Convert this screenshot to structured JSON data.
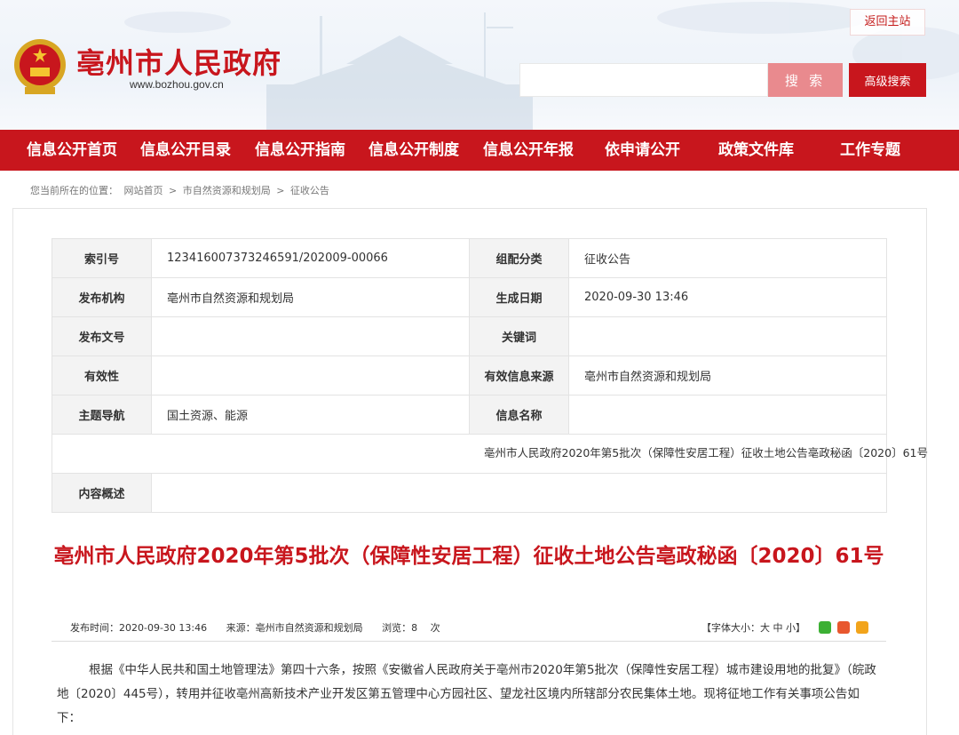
{
  "header": {
    "site_title": "亳州市人民政府",
    "site_url": "www.bozhou.gov.cn",
    "home_link": "返回主站",
    "search_placeholder": "",
    "search_button": "搜 索",
    "advanced_search": "高级搜索"
  },
  "nav": [
    {
      "label": "信息公开首页"
    },
    {
      "label": "信息公开目录"
    },
    {
      "label": "信息公开指南"
    },
    {
      "label": "信息公开制度"
    },
    {
      "label": "信息公开年报"
    },
    {
      "label": "依申请公开"
    },
    {
      "label": "政策文件库"
    },
    {
      "label": "工作专题"
    }
  ],
  "breadcrumb": {
    "prefix": "您当前所在的位置：",
    "items": [
      "网站首页",
      "市自然资源和规划局",
      "征收公告"
    ],
    "separator": ">"
  },
  "meta": {
    "index_label": "索引号",
    "index_value": "123416007373246591/202009-00066",
    "category_label": "组配分类",
    "category_value": "征收公告",
    "publisher_label": "发布机构",
    "publisher_value": "亳州市自然资源和规划局",
    "date_label": "生成日期",
    "date_value": "2020-09-30 13:46",
    "docno_label": "发布文号",
    "docno_value": "",
    "keywords_label": "关键词",
    "keywords_value": "",
    "validity_label": "有效性",
    "validity_value": "",
    "source_label": "有效信息来源",
    "source_value": "亳州市自然资源和规划局",
    "topic_label": "主题导航",
    "topic_value": "国土资源、能源",
    "infoname_label": "信息名称",
    "infoname_value": "亳州市人民政府2020年第5批次（保障性安居工程）征收土地公告亳政秘函〔2020〕61号",
    "summary_label": "内容概述",
    "summary_value": ""
  },
  "article": {
    "title": "亳州市人民政府2020年第5批次（保障性安居工程）征收土地公告亳政秘函〔2020〕61号",
    "publish_time": "发布时间：2020-09-30 13:46",
    "source": "来源：亳州市自然资源和规划局",
    "views": "浏览：8　 次",
    "font_size": "【字体大小：大 中 小】",
    "body": "根据《中华人民共和国土地管理法》第四十六条，按照《安徽省人民政府关于亳州市2020年第5批次（保障性安居工程）城市建设用地的批复》（皖政地〔2020〕445号），转用并征收亳州高新技术产业开发区第五管理中心方园社区、望龙社区境内所辖部分农民集体土地。现将征地工作有关事项公告如下："
  },
  "colors": {
    "brand_red": "#c8161d",
    "search_pink": "#e98a8e",
    "label_bg": "#f3f3f3"
  }
}
